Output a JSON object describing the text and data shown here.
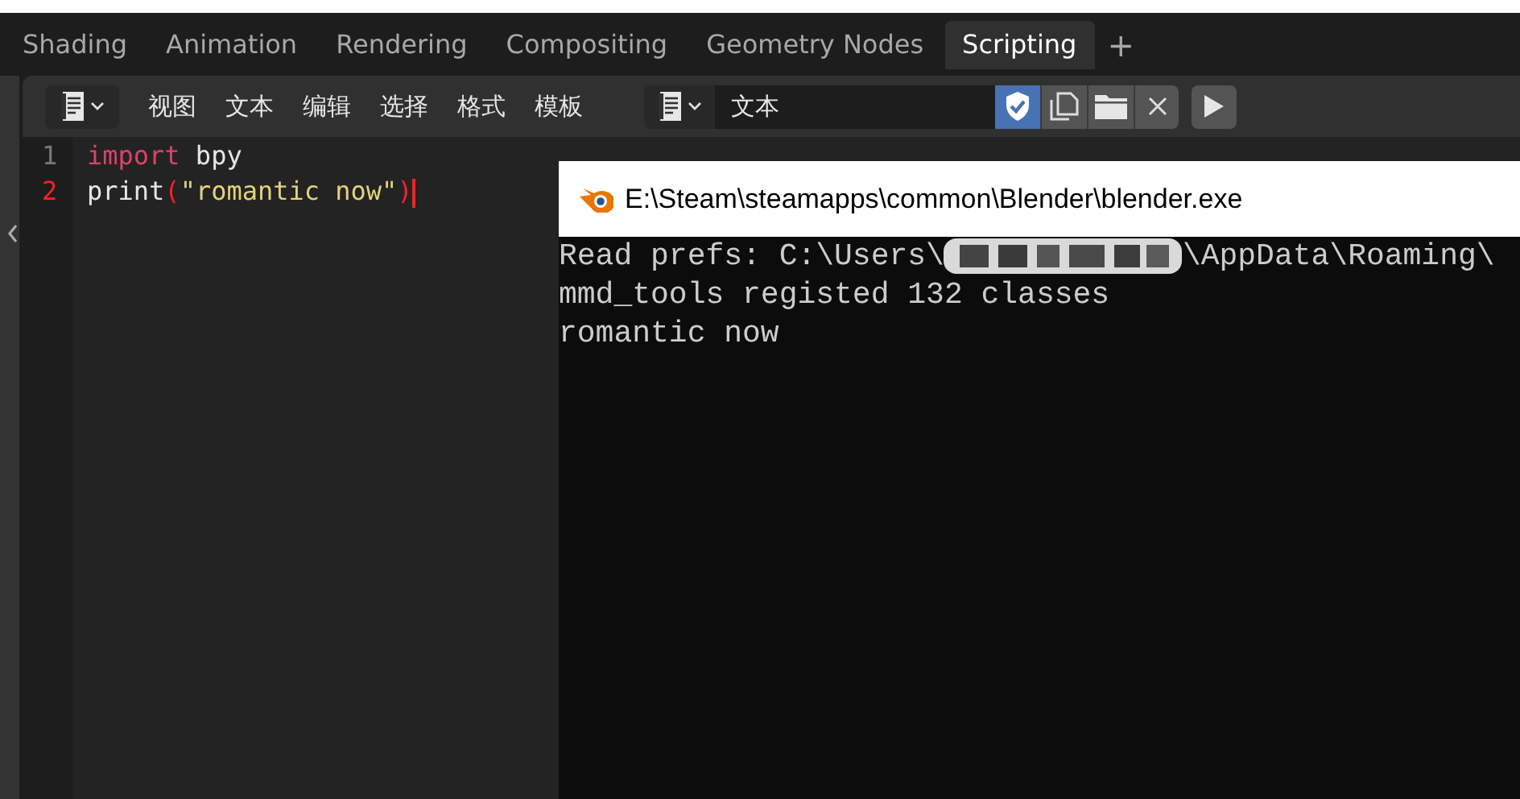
{
  "tabs": [
    {
      "label": "Shading",
      "selected": false
    },
    {
      "label": "Animation",
      "selected": false
    },
    {
      "label": "Rendering",
      "selected": false
    },
    {
      "label": "Compositing",
      "selected": false
    },
    {
      "label": "Geometry Nodes",
      "selected": false
    },
    {
      "label": "Scripting",
      "selected": true
    }
  ],
  "add_tab": "+",
  "editor_menu": [
    "视图",
    "文本",
    "编辑",
    "选择",
    "格式",
    "模板"
  ],
  "text_name": "文本",
  "registered": true,
  "code_lines": [
    {
      "number": "1",
      "current": false,
      "tokens": [
        {
          "kind": "keyword",
          "text": "import"
        },
        {
          "kind": "plain",
          "text": " bpy"
        }
      ]
    },
    {
      "number": "2",
      "current": true,
      "tokens": [
        {
          "kind": "plain",
          "text": "print"
        },
        {
          "kind": "bracket",
          "text": "("
        },
        {
          "kind": "string",
          "text": "\"romantic now\""
        },
        {
          "kind": "bracket",
          "text": ")"
        }
      ]
    }
  ],
  "console": {
    "title": "E:\\Steam\\steamapps\\common\\Blender\\blender.exe",
    "lines": [
      {
        "kind": "redacted",
        "before": "Read prefs: C:\\Users\\",
        "after": "\\AppData\\Roaming\\"
      },
      {
        "kind": "plain",
        "text": "mmd_tools registed 132 classes"
      },
      {
        "kind": "plain",
        "text": "romantic now"
      }
    ]
  }
}
